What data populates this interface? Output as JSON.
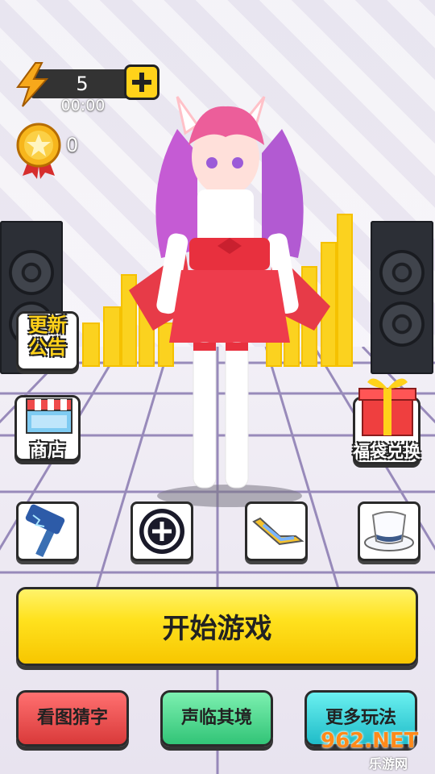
{
  "hud": {
    "energy": "5",
    "timer": "00:00",
    "coins": "0"
  },
  "buttons": {
    "announcement": "更新\n公告",
    "shop": "商店",
    "lucky_bag": "福袋兑换",
    "start": "开始游戏",
    "guess_word": "看图猜字",
    "immersive": "声临其境",
    "more_games": "更多玩法"
  },
  "items": [
    "hammer",
    "coin-emblem",
    "boomerang",
    "top-hat"
  ],
  "watermark": {
    "brand": "962.NET",
    "sub": "乐游网"
  },
  "colors": {
    "yellow": "#ffd21a",
    "red_button": "#e84a4a",
    "green_button": "#4fd98f",
    "cyan_button": "#2fd6d6"
  }
}
